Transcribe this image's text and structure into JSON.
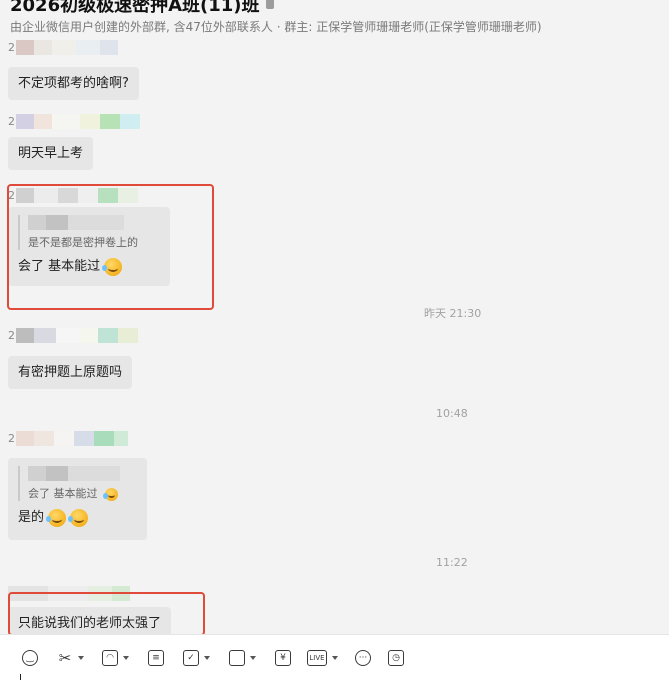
{
  "header": {
    "title": "2026初级极速密押A班(11)班",
    "subtitle": "由企业微信用户创建的外部群, 含47位外部联系人 · 群主: 正保学管师珊珊老师(正保学管师珊珊老师)"
  },
  "messages": [
    {
      "sender_lead": "2",
      "text": "不定项都考的啥啊?"
    },
    {
      "sender_lead": "2",
      "text": "明天早上考"
    },
    {
      "sender_lead": "2",
      "quote": "是不是都是密押卷上的",
      "text": "会了 基本能过",
      "emoji": "laughing-crying-emoji"
    },
    {
      "sender_lead": "2",
      "text": "有密押题上原题吗"
    },
    {
      "sender_lead": "2",
      "quote": "会了 基本能过",
      "text": "是的",
      "emoji": "laughing-crying-emoji"
    },
    {
      "sender_lead": "",
      "text": "只能说我们的老师太强了"
    }
  ],
  "timestamps": [
    "昨天 21:30",
    "10:48",
    "11:22"
  ],
  "toolbar": {
    "items": [
      "emoji-icon",
      "scissors-icon",
      "image-icon",
      "document-icon",
      "checkbox-icon",
      "folder-icon",
      "red-packet-icon",
      "live-icon",
      "more-icon",
      "history-icon"
    ],
    "live_label": "LIVE",
    "yuan_symbol": "¥"
  }
}
